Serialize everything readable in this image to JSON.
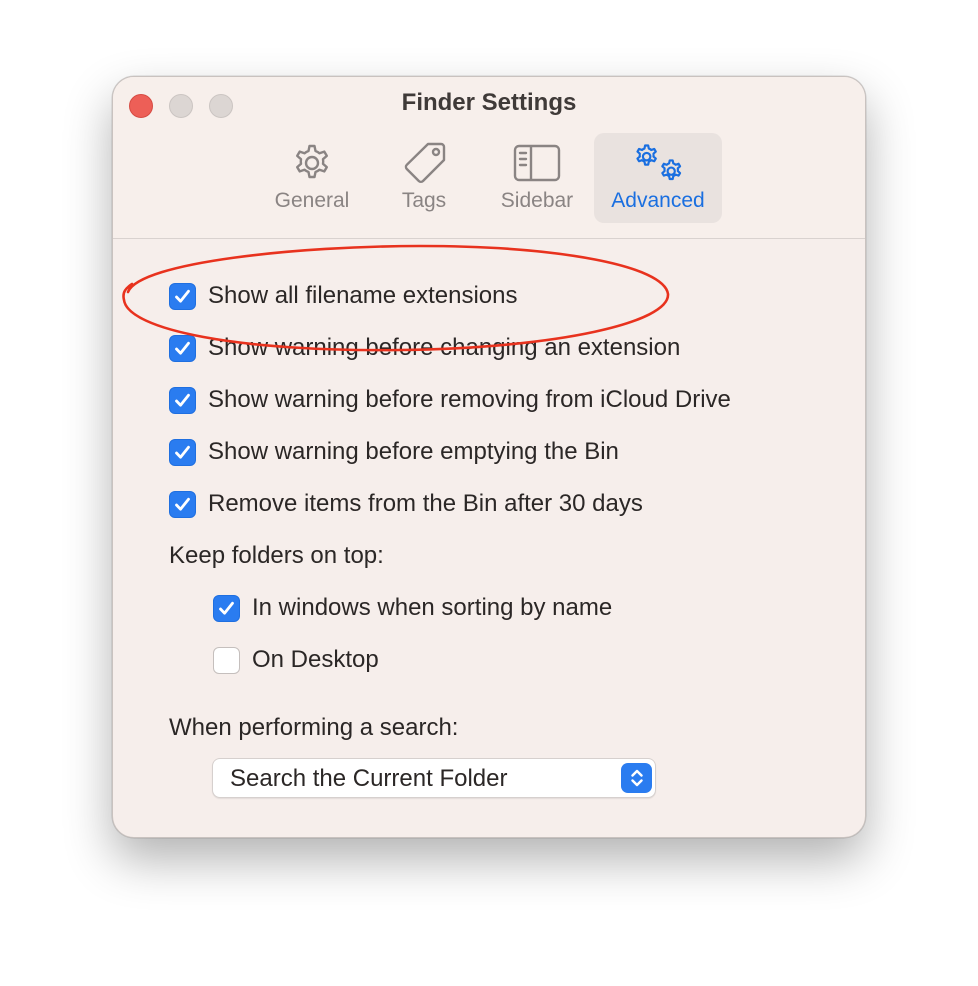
{
  "window": {
    "title": "Finder Settings"
  },
  "tabs": [
    {
      "label": "General",
      "icon": "gear-icon",
      "active": false
    },
    {
      "label": "Tags",
      "icon": "tag-icon",
      "active": false
    },
    {
      "label": "Sidebar",
      "icon": "sidebar-icon",
      "active": false
    },
    {
      "label": "Advanced",
      "icon": "gears-icon",
      "active": true
    }
  ],
  "options": [
    {
      "label": "Show all filename extensions",
      "checked": true
    },
    {
      "label": "Show warning before changing an extension",
      "checked": true
    },
    {
      "label": "Show warning before removing from iCloud Drive",
      "checked": true
    },
    {
      "label": "Show warning before emptying the Bin",
      "checked": true
    },
    {
      "label": "Remove items from the Bin after 30 days",
      "checked": true
    }
  ],
  "keep_folders": {
    "label": "Keep folders on top:",
    "options": [
      {
        "label": "In windows when sorting by name",
        "checked": true
      },
      {
        "label": "On Desktop",
        "checked": false
      }
    ]
  },
  "search": {
    "label": "When performing a search:",
    "selected": "Search the Current Folder"
  },
  "colors": {
    "accent": "#2a7cf0",
    "annotation": "#e8321e",
    "window_bg": "#f6eeeb"
  }
}
